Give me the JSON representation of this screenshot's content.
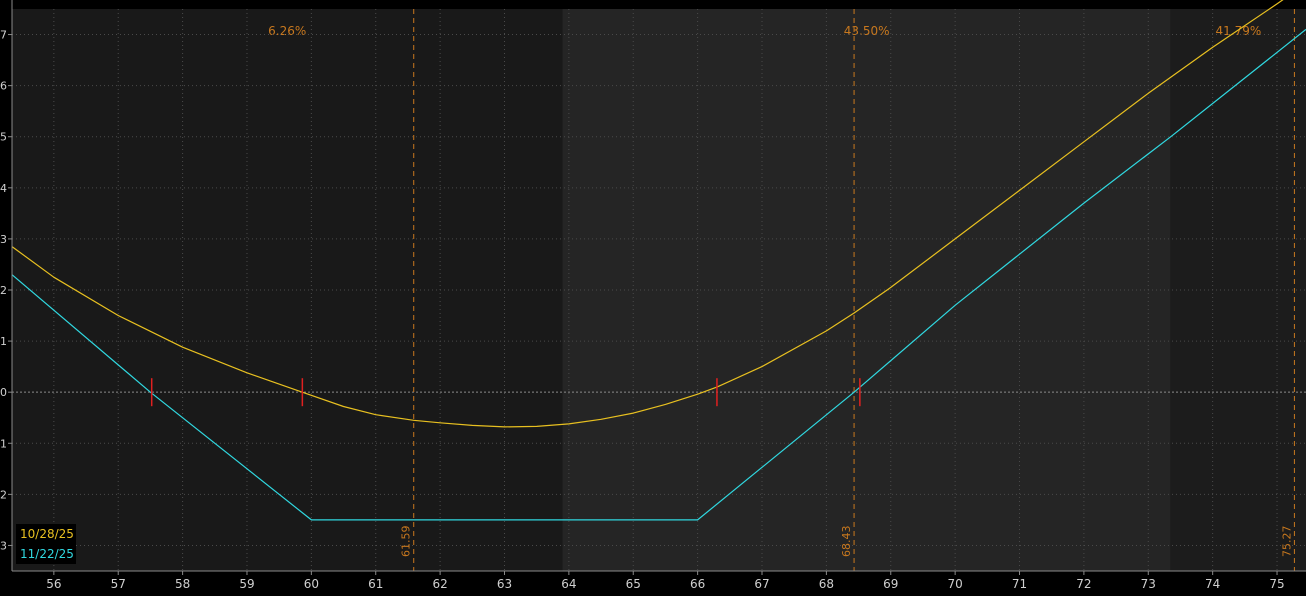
{
  "chart_data": {
    "type": "line",
    "xlim": [
      55.35,
      75.45
    ],
    "ylim": [
      -3.5,
      7.5
    ],
    "x_ticks": [
      56,
      57,
      58,
      59,
      60,
      61,
      62,
      63,
      64,
      65,
      66,
      67,
      68,
      69,
      70,
      71,
      72,
      73,
      74,
      75
    ],
    "grid": true,
    "probability_zones": [
      {
        "from": 55.35,
        "to": 63.9,
        "label": "6.26%"
      },
      {
        "from": 63.9,
        "to": 73.35,
        "label": "43.50%"
      },
      {
        "from": 73.35,
        "to": 75.45,
        "label": "41.79%"
      }
    ],
    "reference_lines": [
      {
        "x": 61.59,
        "label": "61.59"
      },
      {
        "x": 68.43,
        "label": "68.43"
      },
      {
        "x": 75.27,
        "label": "75.27"
      }
    ],
    "series": [
      {
        "name": "10/28/25",
        "color": "#e8c020",
        "x": [
          55.35,
          56,
          57,
          58,
          59,
          59.86,
          60.5,
          61,
          61.59,
          62,
          62.5,
          63,
          63.5,
          64,
          64.5,
          65,
          65.5,
          66,
          66.3,
          67,
          68,
          68.43,
          69,
          70,
          71,
          72,
          73,
          74,
          75,
          75.45
        ],
        "y": [
          2.85,
          2.25,
          1.5,
          0.88,
          0.38,
          0.0,
          -0.28,
          -0.44,
          -0.55,
          -0.6,
          -0.65,
          -0.68,
          -0.67,
          -0.62,
          -0.53,
          -0.41,
          -0.24,
          -0.04,
          0.1,
          0.5,
          1.2,
          1.55,
          2.05,
          3.0,
          3.95,
          4.9,
          5.85,
          6.75,
          7.6,
          8.0
        ]
      },
      {
        "name": "11/22/25",
        "color": "#30d8e0",
        "x": [
          55.35,
          57.5,
          60.0,
          62,
          64,
          66.0,
          68.43,
          70,
          72,
          73.35,
          75.45
        ],
        "y": [
          2.3,
          0.0,
          -2.5,
          -2.5,
          -2.5,
          -2.5,
          0.0,
          1.7,
          3.7,
          5.0,
          7.1
        ]
      }
    ],
    "breakeven_markers": [
      57.52,
      59.86,
      66.3,
      68.52
    ],
    "zero_line": 0
  }
}
